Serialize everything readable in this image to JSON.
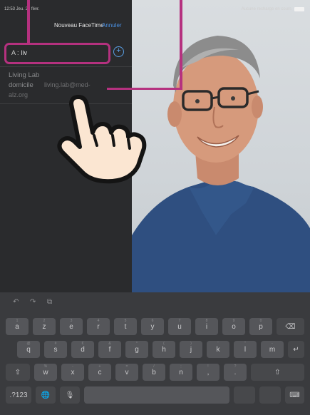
{
  "status": {
    "time": "12:53  Jeu. 27 févr.",
    "charging": "Aucune recharge en cours"
  },
  "facetime": {
    "title": "Nouveau FaceTime",
    "cancel": "Annuler",
    "to_label": "A :",
    "to_value": "liv",
    "add_symbol": "+"
  },
  "suggestion": {
    "name": "Living Lab",
    "label": "domicile",
    "email_line1": "living.lab@med-",
    "email_line2": "alz.org"
  },
  "keyboard": {
    "toolbar": [
      "↶",
      "↷",
      "⧉"
    ],
    "row1": [
      {
        "label": "a",
        "alt": "1"
      },
      {
        "label": "z",
        "alt": "2"
      },
      {
        "label": "e",
        "alt": "3"
      },
      {
        "label": "r",
        "alt": "4"
      },
      {
        "label": "t",
        "alt": "5"
      },
      {
        "label": "y",
        "alt": "6"
      },
      {
        "label": "u",
        "alt": "7"
      },
      {
        "label": "i",
        "alt": "8"
      },
      {
        "label": "o",
        "alt": "9"
      },
      {
        "label": "p",
        "alt": "0"
      }
    ],
    "row2": [
      {
        "label": "q",
        "alt": "@"
      },
      {
        "label": "s",
        "alt": "#"
      },
      {
        "label": "d",
        "alt": "€"
      },
      {
        "label": "f",
        "alt": "&"
      },
      {
        "label": "g",
        "alt": "*"
      },
      {
        "label": "h",
        "alt": "("
      },
      {
        "label": "j",
        "alt": ")"
      },
      {
        "label": "k",
        "alt": "'"
      },
      {
        "label": "l",
        "alt": "\""
      },
      {
        "label": "m",
        "alt": "-"
      }
    ],
    "row3": [
      {
        "label": "w",
        "alt": "%"
      },
      {
        "label": "x",
        "alt": "-"
      },
      {
        "label": "c",
        "alt": "+"
      },
      {
        "label": "v",
        "alt": "="
      },
      {
        "label": "b",
        "alt": "/"
      },
      {
        "label": "n",
        "alt": ";"
      },
      {
        "label": ",",
        "alt": "!"
      },
      {
        "label": ".",
        "alt": "?"
      }
    ],
    "backspace": "⌫",
    "return": "↵",
    "shift": "⇧",
    "numbers": ".?123",
    "globe": "🌐",
    "mic": "🎙",
    "space": "",
    "dismiss": "⌨"
  }
}
